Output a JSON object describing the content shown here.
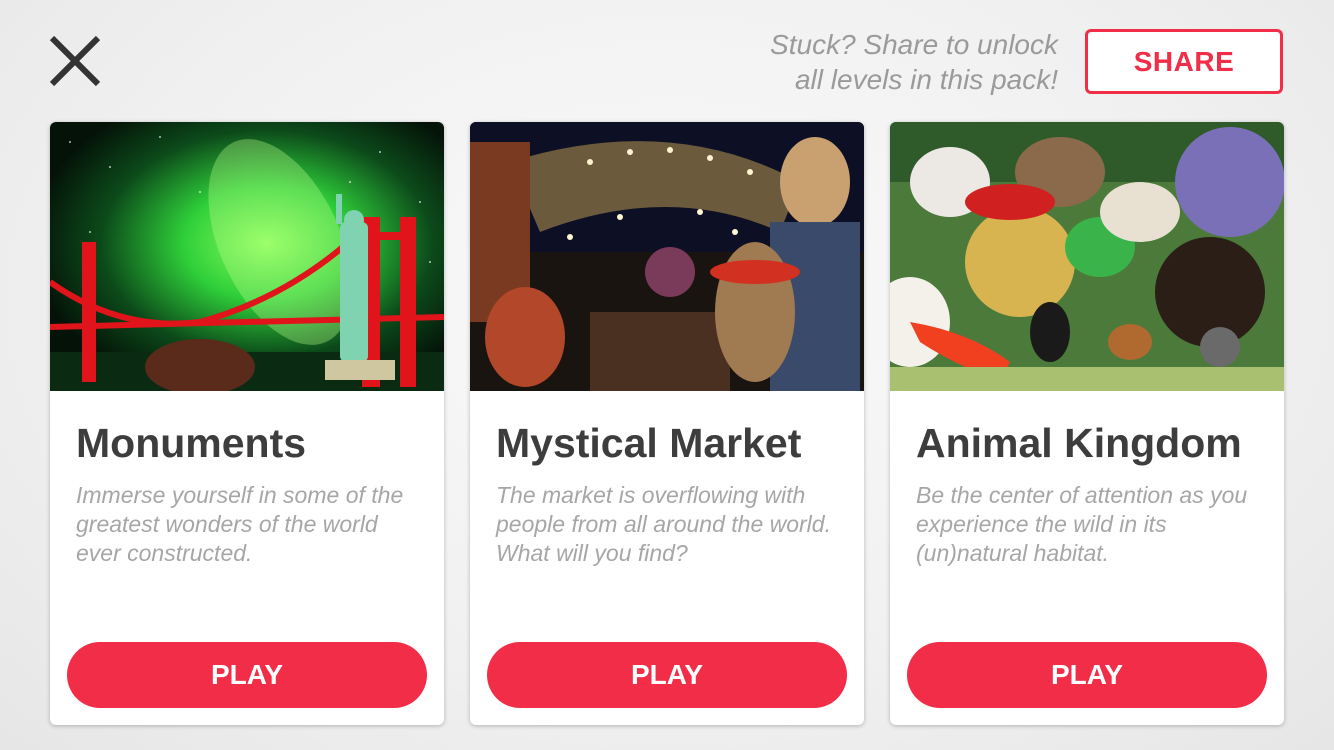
{
  "header": {
    "close_icon": "close-x-icon",
    "share_message_line1": "Stuck? Share to unlock",
    "share_message_line2": "all levels in this pack!",
    "share_label": "SHARE"
  },
  "colors": {
    "accent": "#f22d48",
    "title_text": "#3d3d3d",
    "description_text": "#a6a6a6"
  },
  "packs": [
    {
      "title": "Monuments",
      "description": "Immerse yourself in some of the greatest wonders of the world ever constructed.",
      "play_label": "PLAY"
    },
    {
      "title": "Mystical Market",
      "description": "The market is overflowing with people from all around the world. What will you find?",
      "play_label": "PLAY"
    },
    {
      "title": "Animal Kingdom",
      "description": "Be the center of attention as you experience the wild in its (un)natural habitat.",
      "play_label": "PLAY"
    }
  ]
}
